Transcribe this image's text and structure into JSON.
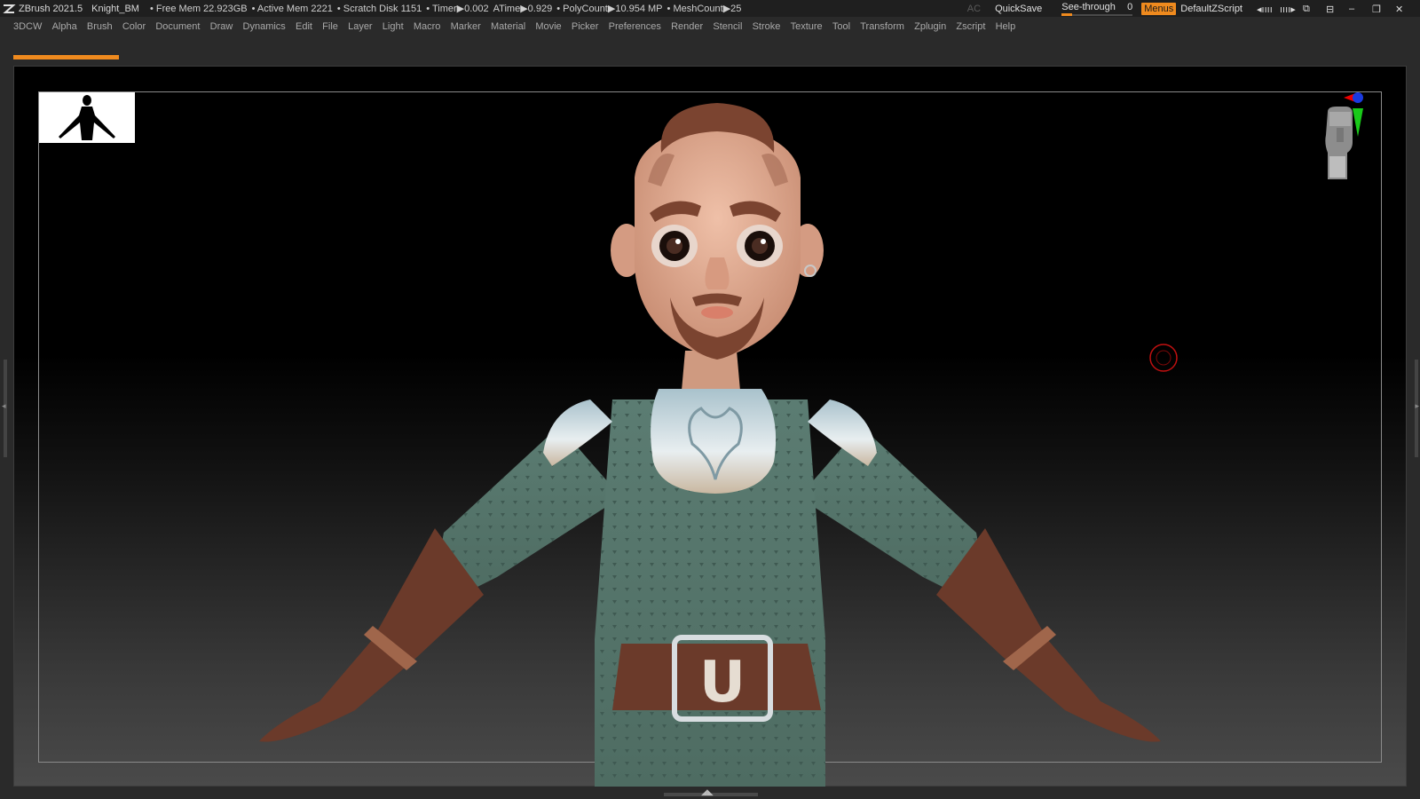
{
  "titlebar": {
    "app": "ZBrush 2021.5",
    "project": "Knight_BM",
    "free_mem": "• Free Mem 22.923GB",
    "active_mem": "• Active Mem 2221",
    "scratch": "• Scratch Disk 1151",
    "timer": "• Timer▶0.002",
    "atime": "ATime▶0.929",
    "polycount": "• PolyCount▶10.954 MP",
    "meshcount": "• MeshCount▶25",
    "ac": "AC",
    "quicksave": "QuickSave",
    "see_through_label": "See-through",
    "see_through_value": "0",
    "menus": "Menus",
    "script": "DefaultZScript"
  },
  "menu_items": [
    "3DCW",
    "Alpha",
    "Brush",
    "Color",
    "Document",
    "Draw",
    "Dynamics",
    "Edit",
    "File",
    "Layer",
    "Light",
    "Macro",
    "Marker",
    "Material",
    "Movie",
    "Picker",
    "Preferences",
    "Render",
    "Stencil",
    "Stroke",
    "Texture",
    "Tool",
    "Transform",
    "Zplugin",
    "Zscript",
    "Help"
  ],
  "belt_buckle_letter": "U",
  "colors": {
    "accent": "#ef8a1e",
    "ui_bg": "#2a2a2a",
    "titlebar_bg": "#1f1f1f",
    "shirt": "#5e8075",
    "leather": "#6b3a2a",
    "skin": "#d9a58c",
    "metal": "#c9d4d8"
  },
  "icons": {
    "logo": "zbrush-logo-icon",
    "window_controls": [
      "minimize-icon",
      "restore-icon",
      "close-icon"
    ]
  }
}
